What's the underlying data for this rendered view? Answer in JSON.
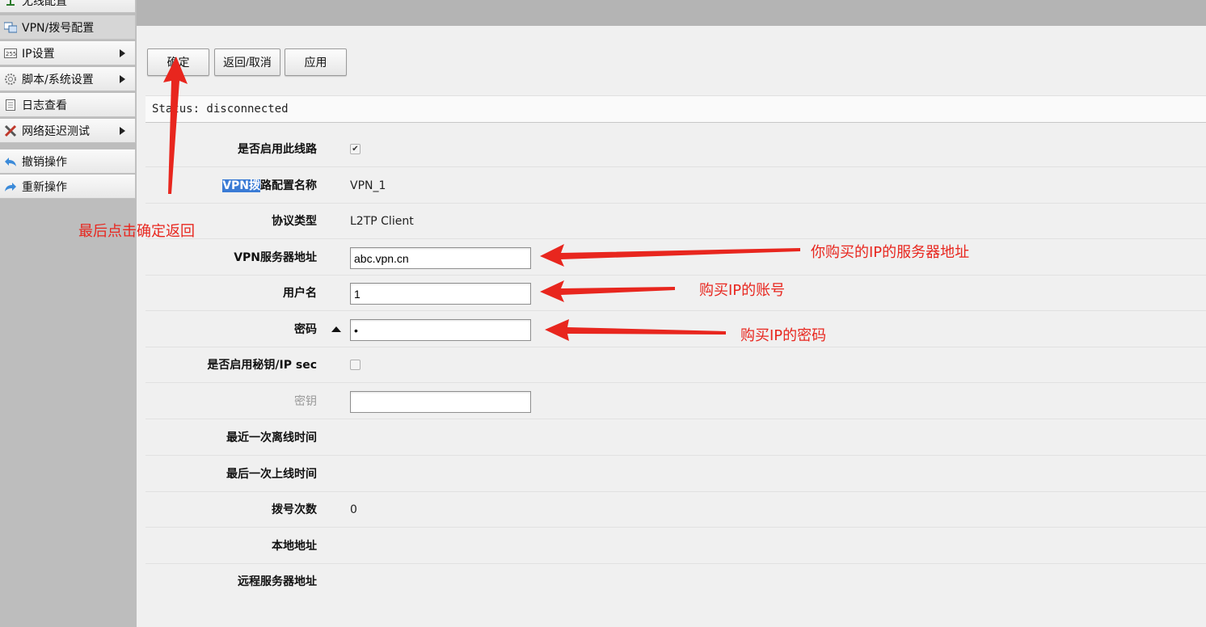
{
  "sidebar": {
    "items": [
      {
        "label": "无线配置",
        "icon": "wireless-icon",
        "has_arrow": false
      },
      {
        "label": "VPN/拨号配置",
        "icon": "vpn-icon",
        "has_arrow": false,
        "active": true
      },
      {
        "label": "IP设置",
        "icon": "ip-icon",
        "has_arrow": true
      },
      {
        "label": "脚本/系统设置",
        "icon": "gear-icon",
        "has_arrow": true
      },
      {
        "label": "日志查看",
        "icon": "log-icon",
        "has_arrow": false
      },
      {
        "label": "网络延迟测试",
        "icon": "tools-icon",
        "has_arrow": true
      },
      {
        "label": "撤销操作",
        "icon": "undo-icon",
        "has_arrow": false
      },
      {
        "label": "重新操作",
        "icon": "redo-icon",
        "has_arrow": false
      }
    ]
  },
  "toolbar": {
    "ok_label": "确定",
    "cancel_label": "返回/取消",
    "apply_label": "应用"
  },
  "status": {
    "text": "Status: disconnected"
  },
  "form": {
    "enable_label": "是否启用此线路",
    "enable_checked": true,
    "name_label_highlight": "VPN拨",
    "name_label_rest": "路配置名称",
    "name_value": "VPN_1",
    "protocol_label": "协议类型",
    "protocol_value": "L2TP Client",
    "server_label": "VPN服务器地址",
    "server_value": "abc.vpn.cn",
    "username_label": "用户名",
    "username_value": "1",
    "password_label": "密码",
    "password_value": "•",
    "ipsec_label": "是否启用秘钥/IP sec",
    "ipsec_checked": false,
    "secret_label": "密钥",
    "secret_value": "",
    "last_offline_label": "最近一次离线时间",
    "last_online_label": "最后一次上线时间",
    "dial_count_label": "拨号次数",
    "dial_count_value": "0",
    "local_addr_label": "本地地址",
    "remote_addr_label": "远程服务器地址"
  },
  "annotations": {
    "ok_hint": "最后点击确定返回",
    "server_hint": "你购买的IP的服务器地址",
    "username_hint": "购买IP的账号",
    "password_hint": "购买IP的密码",
    "color": "#e8261e"
  }
}
